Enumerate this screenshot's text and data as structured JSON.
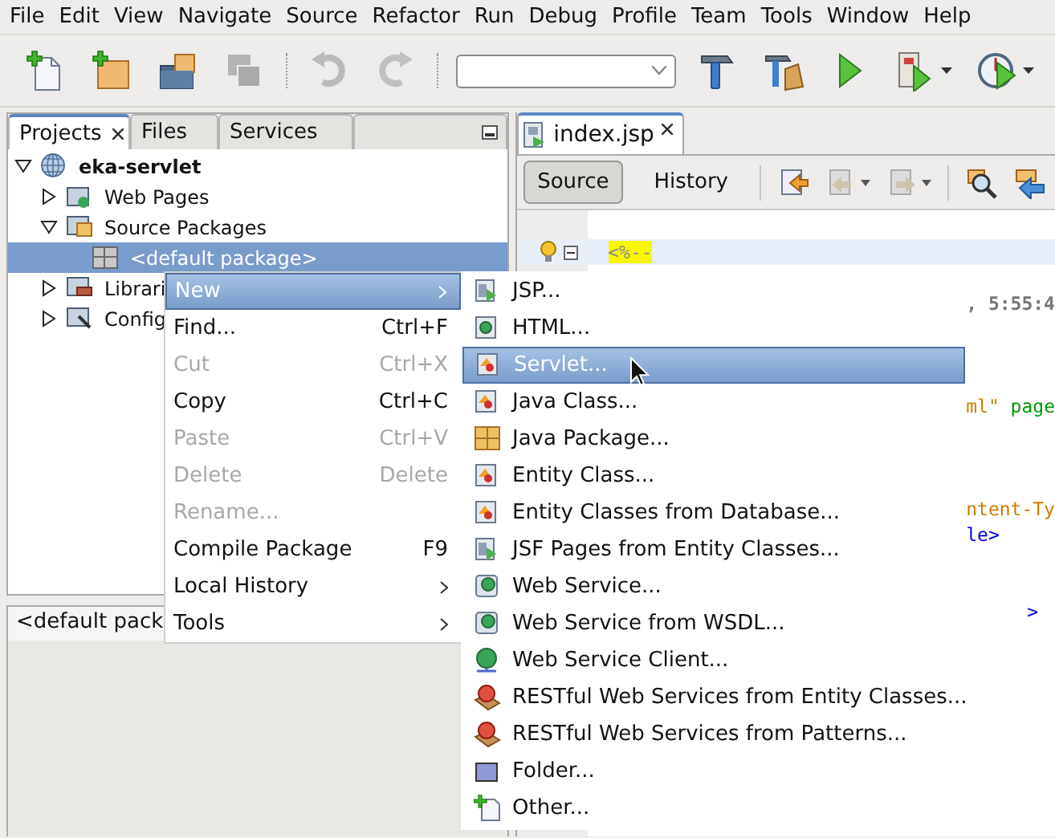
{
  "menu_bar": [
    {
      "label": "File"
    },
    {
      "label": "Edit"
    },
    {
      "label": "View"
    },
    {
      "label": "Navigate"
    },
    {
      "label": "Source"
    },
    {
      "label": "Refactor"
    },
    {
      "label": "Run"
    },
    {
      "label": "Debug"
    },
    {
      "label": "Profile"
    },
    {
      "label": "Team"
    },
    {
      "label": "Tools"
    },
    {
      "label": "Window"
    },
    {
      "label": "Help"
    }
  ],
  "toolbar": [
    {
      "kind": "new-file",
      "disabled": false
    },
    {
      "kind": "new-project",
      "disabled": false
    },
    {
      "kind": "open-project",
      "disabled": false
    },
    {
      "kind": "save",
      "disabled": true
    },
    {
      "kind": "sep"
    },
    {
      "kind": "undo",
      "disabled": true
    },
    {
      "kind": "redo",
      "disabled": true
    },
    {
      "kind": "sep"
    },
    {
      "kind": "combo"
    },
    {
      "kind": "build",
      "disabled": false
    },
    {
      "kind": "clean",
      "disabled": false
    },
    {
      "kind": "run",
      "disabled": false
    },
    {
      "kind": "debug",
      "disabled": false,
      "dropdown": true
    },
    {
      "kind": "profile",
      "disabled": false,
      "dropdown": true
    }
  ],
  "projects_panel": {
    "tabs": [
      {
        "label": "Projects",
        "selected": true,
        "closable": true
      },
      {
        "label": "Files",
        "selected": false,
        "closable": false
      },
      {
        "label": "Services",
        "selected": false,
        "closable": false
      }
    ],
    "tree": [
      {
        "label": "eka-servlet",
        "kind": "web-project",
        "expanded": true,
        "selected": false,
        "children": [
          {
            "label": "Web Pages",
            "kind": "web-pages",
            "expanded": false,
            "selected": false
          },
          {
            "label": "Source Packages",
            "kind": "source-packages",
            "expanded": true,
            "selected": false,
            "children": [
              {
                "label": "<default package>",
                "kind": "package",
                "selected": true
              }
            ]
          },
          {
            "label": "Librari",
            "kind": "libraries",
            "expanded": false,
            "selected": false
          },
          {
            "label": "Config",
            "kind": "config",
            "expanded": false,
            "selected": false
          }
        ]
      }
    ]
  },
  "navigator_panel": {
    "tab": "<default pack"
  },
  "editor": {
    "tabs": [
      {
        "label": "index.jsp",
        "selected": true
      }
    ],
    "view_tabs": [
      {
        "label": "Source",
        "selected": true
      },
      {
        "label": "History",
        "selected": false
      }
    ],
    "code_lines": [
      {
        "kind": "fold",
        "tokens": [
          {
            "text": "<%--",
            "kind": "comment-highlight"
          }
        ]
      },
      {
        "kind": "blank"
      },
      {
        "kind": "code",
        "tokens": [
          {
            "text": ", 5:55:4",
            "kind": "comment"
          }
        ]
      },
      {
        "kind": "blank"
      },
      {
        "kind": "blank"
      },
      {
        "kind": "blank"
      },
      {
        "kind": "code",
        "tokens": [
          {
            "text": "ml\"",
            "kind": "string"
          },
          {
            "text": " page",
            "kind": "attribute"
          }
        ]
      },
      {
        "kind": "blank"
      },
      {
        "kind": "blank"
      },
      {
        "kind": "blank"
      },
      {
        "kind": "code",
        "tokens": [
          {
            "text": "ntent-Ty",
            "kind": "string"
          }
        ]
      },
      {
        "kind": "code",
        "tokens": [
          {
            "text": "le>",
            "kind": "tag"
          }
        ]
      },
      {
        "kind": "blank"
      },
      {
        "kind": "blank"
      },
      {
        "kind": "code-end",
        "tokens": [
          {
            "text": ">",
            "kind": "tag"
          }
        ]
      }
    ]
  },
  "context_menu": {
    "items": [
      {
        "label": "New",
        "submenu": true,
        "disabled": false,
        "selected": true
      },
      {
        "label": "Find...",
        "shortcut": "Ctrl+F",
        "submenu": false,
        "disabled": false,
        "selected": false
      },
      {
        "label": "Cut",
        "shortcut": "Ctrl+X",
        "submenu": false,
        "disabled": true,
        "selected": false
      },
      {
        "label": "Copy",
        "shortcut": "Ctrl+C",
        "submenu": false,
        "disabled": false,
        "selected": false
      },
      {
        "label": "Paste",
        "shortcut": "Ctrl+V",
        "submenu": false,
        "disabled": true,
        "selected": false
      },
      {
        "label": "Delete",
        "shortcut": "Delete",
        "submenu": false,
        "disabled": true,
        "selected": false
      },
      {
        "label": "Rename...",
        "submenu": false,
        "disabled": true,
        "selected": false
      },
      {
        "label": "Compile Package",
        "shortcut": "F9",
        "submenu": false,
        "disabled": false,
        "selected": false
      },
      {
        "label": "Local History",
        "submenu": true,
        "disabled": false,
        "selected": false
      },
      {
        "label": "Tools",
        "submenu": true,
        "disabled": false,
        "selected": false
      }
    ]
  },
  "new_submenu": {
    "items": [
      {
        "label": "JSP...",
        "kind": "jsp",
        "selected": false
      },
      {
        "label": "HTML...",
        "kind": "html",
        "selected": false
      },
      {
        "label": "Servlet...",
        "kind": "class",
        "selected": true
      },
      {
        "label": "Java Class...",
        "kind": "class",
        "selected": false
      },
      {
        "label": "Java Package...",
        "kind": "package",
        "selected": false
      },
      {
        "label": "Entity Class...",
        "kind": "class",
        "selected": false
      },
      {
        "label": "Entity Classes from Database...",
        "kind": "class",
        "selected": false
      },
      {
        "label": "JSF Pages from Entity Classes...",
        "kind": "jsp",
        "selected": false
      },
      {
        "label": "Web Service...",
        "kind": "web-service",
        "selected": false
      },
      {
        "label": "Web Service from WSDL...",
        "kind": "web-service",
        "selected": false
      },
      {
        "label": "Web Service Client...",
        "kind": "ws-client",
        "selected": false
      },
      {
        "label": "RESTful Web Services from Entity Classes...",
        "kind": "rest",
        "selected": false
      },
      {
        "label": "RESTful Web Services from Patterns...",
        "kind": "rest",
        "selected": false
      },
      {
        "label": "Folder...",
        "kind": "folder",
        "selected": false
      },
      {
        "label": "Other...",
        "kind": "other",
        "selected": false
      }
    ]
  }
}
